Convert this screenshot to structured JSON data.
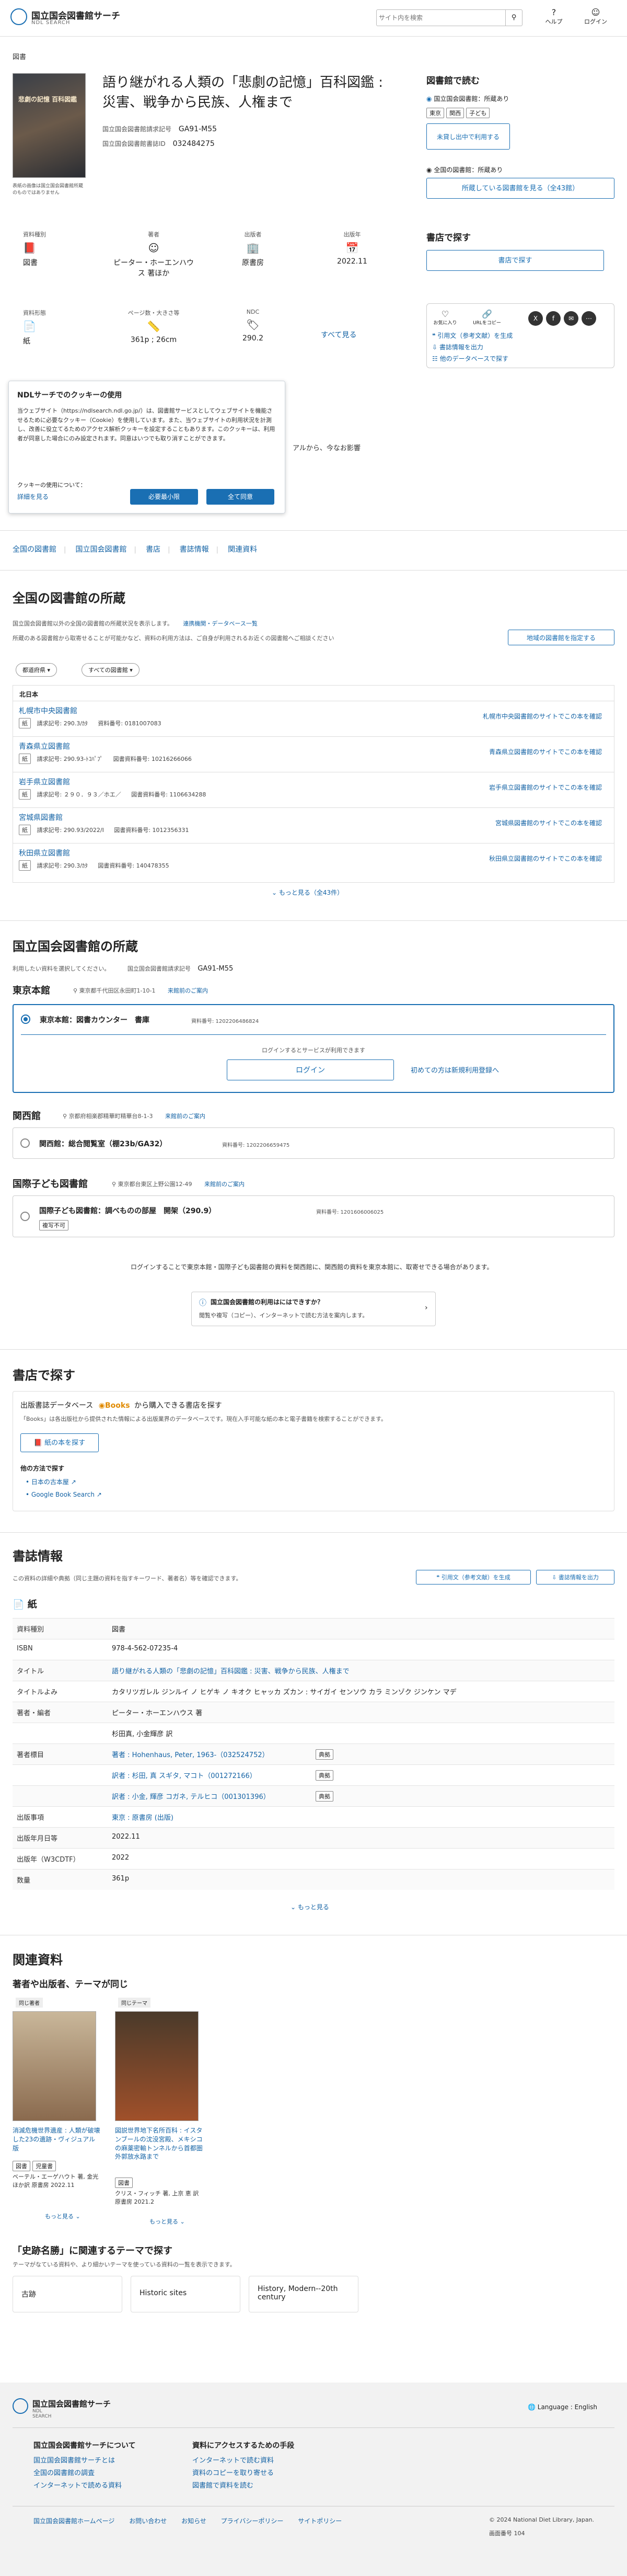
{
  "header": {
    "logo_title": "国立国会図書館サーチ",
    "logo_sub": "NDL SEARCH",
    "search_placeholder": "サイト内を検索",
    "help_label": "ヘルプ",
    "login_label": "ログイン"
  },
  "breadcrumb": "図書",
  "book": {
    "cover_caption": "表紙の画像は国立国会図書館所蔵のものではありません",
    "title": "語り継がれる人類の「悲劇の記憶」百科図鑑 : 災害、戦争から民族、人権まで",
    "ndc_label": "国立国会図書館請求記号",
    "ndc_value": "GA91-M55",
    "bib_id_label": "国立国会図書館書誌ID",
    "bib_id_value": "032484275",
    "meta": [
      {
        "label": "資料種別",
        "icon": "book-icon",
        "value": "図書"
      },
      {
        "label": "著者",
        "icon": "person-icon",
        "value": "ピーター・ホーエンハウス 著ほか"
      },
      {
        "label": "出版者",
        "icon": "building-icon",
        "value": "原書房"
      },
      {
        "label": "出版年",
        "icon": "calendar-icon",
        "value": "2022.11"
      },
      {
        "label": "資料形態",
        "icon": "paper-icon",
        "value": "紙"
      },
      {
        "label": "ページ数・大きさ等",
        "icon": "ruler-icon",
        "value": "361p ; 26cm"
      },
      {
        "label": "NDC",
        "icon": "tag-icon",
        "value": "290.2"
      }
    ],
    "show_all": "すべて見る",
    "desc_visible": "アルから、今なお影響"
  },
  "read_side": {
    "title": "図書館で読む",
    "ndl_label": "国立国会図書館：所蔵あり",
    "tags": [
      "東京",
      "関西",
      "子ども"
    ],
    "unavailable_btn": "未貸し出中で利用する",
    "all_lib_label": "全国の図書館：所蔵あり",
    "holdings_btn": "所蔵している図書館を見る（全43館）",
    "buy_title": "書店で探す",
    "buy_btn": "書店で探す",
    "share_labels": [
      "お気に入り",
      "URLをコピー",
      "X",
      "Facebook",
      "メール",
      "その他"
    ],
    "links": [
      "引用文（参考文献）を生成",
      "書誌情報を出力",
      "他のデータベースで探す"
    ]
  },
  "cookie": {
    "title": "NDLサーチでのクッキーの使用",
    "text": "当ウェブサイト（https://ndlsearch.ndl.go.jp/）は、図書館サービスとしてウェブサイトを機能させるために必要なクッキー（Cookie）を使用しています。また、当ウェブサイトの利用状況を計測し、改善に役立てるためのアクセス解析クッキーを設定することもあります。このクッキーは、利用者が同意した場合にのみ設定されます。同意はいつでも取り消すことができます。",
    "policy_label": "クッキーの使用について：",
    "detail_link": "詳細を見る",
    "required_btn": "必要最小限",
    "accept_btn": "全て同意"
  },
  "tabs": [
    "全国の図書館",
    "国立国会図書館",
    "書店",
    "書誌情報",
    "関連資料"
  ],
  "national": {
    "title": "全国の図書館の所蔵",
    "note1": "国立国会図書館以外の全国の図書館の所蔵状況を表示します。",
    "note1_link": "連携機関・データベース一覧",
    "note2": "所蔵のある図書館から取寄せることが可能かなど、資料の利用方法は、ご自身が利用されるお近くの図書館へご相談ください",
    "local_btn": "地域の図書館を指定する",
    "filter1": "都道府県",
    "filter2": "すべての図書館",
    "list_header": "北日本",
    "libraries": [
      {
        "name": "札幌市中央図書館",
        "form": "紙",
        "call": "請求記号: 290.3/ｶﾀ",
        "id": "資料番号: 0181007083",
        "link": "札幌市中央図書館のサイトでこの本を確認"
      },
      {
        "name": "青森県立図書館",
        "form": "紙",
        "call": "請求記号: 290.93-ﾄｺﾊﾟﾌﾟ",
        "id": "図書資料番号: 10216266066",
        "link": "青森県立図書館のサイトでこの本を確認"
      },
      {
        "name": "岩手県立図書館",
        "form": "紙",
        "call": "請求記号: ２９０．９３／ホエ／",
        "id": "図書資料番号: 1106634288",
        "link": "岩手県立図書館のサイトでこの本を確認"
      },
      {
        "name": "宮城県図書館",
        "form": "紙",
        "call": "請求記号: 290.93/2022/I",
        "id": "図書資料番号: 1012356331",
        "link": "宮城県図書館のサイトでこの本を確認"
      },
      {
        "name": "秋田県立図書館",
        "form": "紙",
        "call": "請求記号: 290.3/ｶﾀ",
        "id": "図書資料番号: 140478355",
        "link": "秋田県立図書館のサイトでこの本を確認"
      }
    ],
    "more": "もっと見る（全43件）"
  },
  "ndl": {
    "title": "国立国会図書館の所蔵",
    "note": "利用したい資料を選択してください。",
    "call_label": "国立国会図書館請求記号",
    "call_value": "GA91-M55",
    "tokyo": {
      "title": "東京本館",
      "addr": "東京都千代田区永田町1-10-1",
      "guide": "来館前のご案内",
      "counter": "東京本館：図書カウンター　書庫",
      "counter_id": "資料番号: 1202206486824",
      "login_note": "ログインするとサービスが利用できます",
      "login_btn": "ログイン",
      "register_btn": "初めての方は新規利用登録へ"
    },
    "kansai": {
      "title": "関西館",
      "addr": "京都府相楽郡精華町精華台8-1-3",
      "guide": "来館前のご案内",
      "room": "関西館：総合閲覧室（棚23b/GA32）",
      "room_id": "資料番号: 1202206659475"
    },
    "kodomo": {
      "title": "国際子ども図書館",
      "addr": "東京都台東区上野公園12-49",
      "guide": "来館前のご案内",
      "room": "国際子ども図書館：調べものの部屋　開架（290.9）",
      "room_id": "資料番号: 1201606006025",
      "badge": "複写不可"
    },
    "bottom_note": "ログインすることで東京本館・国際子ども図書館の資料を関西館に、関西館の資料を東京本館に、取寄せできる場合があります。",
    "promo_title": "国立国会図書館の利用はにはできすか？",
    "promo_text": "閲覧や複写（コピー）、インターネットで読む方法を案内します。"
  },
  "bookstore": {
    "title": "書店で探す",
    "heading": "出版書誌データベース",
    "brand": "Books",
    "heading_tail": "から購入できる書店を探す",
    "note": "「Books」は各出版社から提供された情報による出版業界のデータベースです。現在入手可能な紙の本と電子書籍を検索することができます。",
    "btn": "紙の本を探す",
    "other_label": "他の方法で探す",
    "links": [
      "日本の古本屋",
      "Google Book Search"
    ]
  },
  "bib": {
    "title": "書誌情報",
    "note": "この資料の詳細や典拠（同じ主題の資料を指すキーワード、著者名）等を確認できます。",
    "cite_btn": "引用文（参考文献）を生成",
    "export_btn": "書誌情報を出力",
    "section": "紙",
    "rows": [
      {
        "key": "資料種別",
        "val": "図書"
      },
      {
        "key": "ISBN",
        "val": "978-4-562-07235-4"
      },
      {
        "key": "タイトル",
        "val": "語り継がれる人類の「悲劇の記憶」百科図鑑 : 災害、戦争から民族、人権まで"
      },
      {
        "key": "タイトルよみ",
        "val": "カタリツガレル ジンルイ ノ ヒゲキ ノ キオク ヒャッカ ズカン : サイガイ センソウ カラ ミンゾク ジンケン マデ"
      },
      {
        "key": "著者・編者",
        "val": "ピーター・ホーエンハウス 著"
      },
      {
        "key": "",
        "val": "杉田真, 小金輝彦 訳"
      },
      {
        "key": "著者標目",
        "val": "著者 : Hohenhaus, Peter, 1963-（032524752）"
      },
      {
        "key": "",
        "val": "訳者 : 杉田, 真 スギタ, マコト（001272166）"
      },
      {
        "key": "",
        "val": "訳者 : 小金, 輝彦 コガネ, テルヒコ（001301396）"
      },
      {
        "key": "出版事項",
        "val": "東京 : 原書房 (出版)"
      },
      {
        "key": "出版年月日等",
        "val": "2022.11"
      },
      {
        "key": "出版年（W3CDTF）",
        "val": "2022"
      },
      {
        "key": "数量",
        "val": "361p"
      }
    ],
    "typed_label": "典拠",
    "more": "もっと見る"
  },
  "related": {
    "title": "関連資料",
    "subtitle": "著者や出版者、テーマが同じ",
    "group1": "同じ著者",
    "group2": "同じテーマ",
    "items": [
      {
        "title": "消滅危機世界遺産 : 人類が破壊した23の遺跡・ヴィジュアル版",
        "tags": [
          "図書",
          "児童書"
        ],
        "author": "ベーテル・エーゲハウト 著, 金光 ほか訳",
        "pub": "原書房",
        "year": "2022.11"
      },
      {
        "title": "図説世界地下名所百科 : イスタンブールの沈没宮殿、メキシコの麻薬密輸トンネルから首都圏外郭放水路まで",
        "tags": [
          "図書"
        ],
        "author": "クリス・フィッチ 著, 上京 恵 訳",
        "pub": "原書房",
        "year": "2021.2"
      }
    ],
    "more": "もっと見る"
  },
  "themes": {
    "title": "「史跡名勝」に関連するテーマで探す",
    "note": "テーマがなている資料や、より細かいテーマを使っている資料の一覧を表示できます。",
    "cards": [
      "古跡",
      "Historic sites",
      "History, Modern--20th century"
    ]
  },
  "footer": {
    "logo_title": "国立国会図書館サーチ",
    "logo_sub": "NDL SEARCH",
    "lang": "Language : English",
    "col1_title": "国立国会図書館サーチについて",
    "col1": [
      "国立国会図書館サーチとは",
      "全国の図書館の調査",
      "インターネットで読める資料"
    ],
    "col2_title": "資料にアクセスするための手段",
    "col2": [
      "インターネットで読む資料",
      "資料のコピーを取り寄せる",
      "図書館で資料を読む"
    ],
    "bottom_links": [
      "国立国会図書館ホームページ",
      "お問い合わせ",
      "お知らせ",
      "プライバシーポリシー",
      "サイトポリシー"
    ],
    "copyright": "© 2024 National Diet Library, Japan.",
    "version_label": "画面番号",
    "version": "104"
  },
  "colors": {
    "accent": "#1a6fb3",
    "link": "#1463a5",
    "footer_bg": "#f2f2f2",
    "cookie_border": "#cfd6dd"
  }
}
